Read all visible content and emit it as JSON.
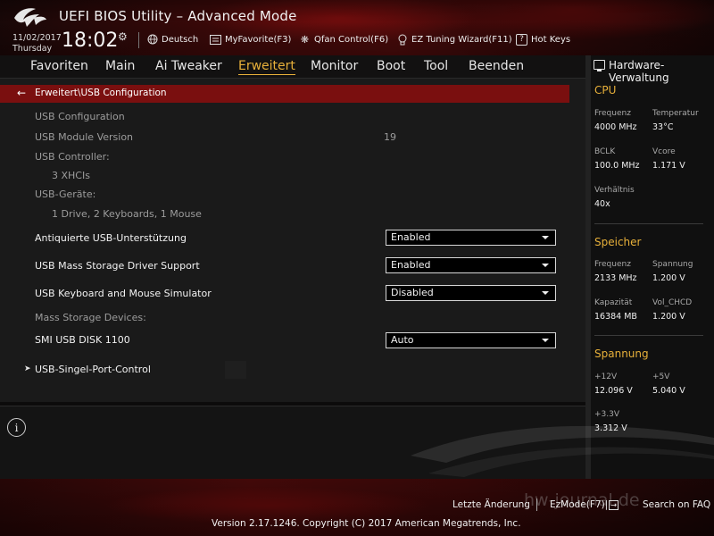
{
  "header": {
    "title": "UEFI BIOS Utility – Advanced Mode",
    "date": "11/02/2017",
    "weekday": "Thursday",
    "time": "18:02",
    "items": [
      {
        "icon": "globe-icon",
        "label": "Deutsch"
      },
      {
        "icon": "favorite-icon",
        "label": "MyFavorite(F3)"
      },
      {
        "icon": "fan-icon",
        "label": "Qfan Control(F6)"
      },
      {
        "icon": "bulb-icon",
        "label": "EZ Tuning Wizard(F11)"
      },
      {
        "icon": "help-icon",
        "label": "Hot Keys"
      }
    ]
  },
  "tabs": [
    {
      "label": "Favoriten",
      "active": false
    },
    {
      "label": "Main",
      "active": false
    },
    {
      "label": "Ai Tweaker",
      "active": false
    },
    {
      "label": "Erweitert",
      "active": true
    },
    {
      "label": "Monitor",
      "active": false
    },
    {
      "label": "Boot",
      "active": false
    },
    {
      "label": "Tool",
      "active": false
    },
    {
      "label": "Beenden",
      "active": false
    }
  ],
  "breadcrumb": "Erweitert\\USB Configuration",
  "info": {
    "usb_configuration": "USB Configuration",
    "usb_module_version_label": "USB Module Version",
    "usb_module_version_value": "19",
    "usb_controller_label": "USB Controller:",
    "usb_controller_value": "3 XHCIs",
    "usb_devices_label": "USB-Geräte:",
    "usb_devices_value": "1 Drive, 2 Keyboards, 1 Mouse",
    "mass_storage_devices_label": "Mass Storage Devices:"
  },
  "settings": [
    {
      "label": "Antiquierte USB-Unterstützung",
      "value": "Enabled"
    },
    {
      "label": "USB Mass Storage Driver Support",
      "value": "Enabled"
    },
    {
      "label": "USB Keyboard and Mouse Simulator",
      "value": "Disabled"
    },
    {
      "label": "SMI USB DISK 1100",
      "value": "Auto"
    }
  ],
  "submenu": "USB-Singel-Port-Control",
  "hardware_monitor": {
    "title": "Hardware-Verwaltung",
    "cpu": {
      "title": "CPU",
      "freq_label": "Frequenz",
      "freq_value": "4000 MHz",
      "temp_label": "Temperatur",
      "temp_value": "33°C",
      "bclk_label": "BCLK",
      "bclk_value": "100.0 MHz",
      "vcore_label": "Vcore",
      "vcore_value": "1.171 V",
      "ratio_label": "Verhältnis",
      "ratio_value": "40x"
    },
    "memory": {
      "title": "Speicher",
      "freq_label": "Frequenz",
      "freq_value": "2133 MHz",
      "volt_label": "Spannung",
      "volt_value": "1.200 V",
      "cap_label": "Kapazität",
      "cap_value": "16384 MB",
      "vol_chcd_label": "Vol_CHCD",
      "vol_chcd_value": "1.200 V"
    },
    "voltage": {
      "title": "Spannung",
      "v12_label": "+12V",
      "v12_value": "12.096 V",
      "v5_label": "+5V",
      "v5_value": "5.040 V",
      "v33_label": "+3.3V",
      "v33_value": "3.312 V"
    }
  },
  "footer": {
    "last_change": "Letzte Änderung",
    "ezmode": "EzMode(F7)|",
    "ezmode_icon_glyph": "→",
    "search": "Search on FAQ",
    "watermark": "hw-journal.de",
    "copyright": "Version 2.17.1246. Copyright (C) 2017 American Megatrends, Inc."
  },
  "colors": {
    "accent": "#e7b03a",
    "breadcrumb_bar": "#7a0f0f",
    "header_red": "#4a0b0b"
  }
}
